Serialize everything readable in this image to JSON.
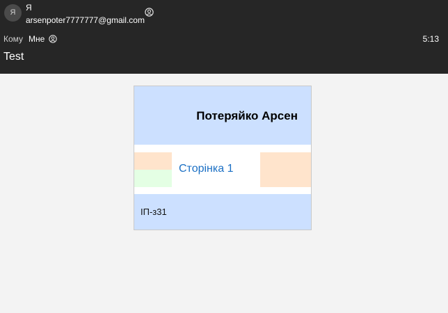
{
  "header": {
    "avatar_letter": "Я",
    "sender_name": "Я",
    "sender_email": "arsenpoter7777777@gmail.com",
    "to_label": "Кому",
    "to_value": "Мне",
    "time": "5:13",
    "subject": "Test"
  },
  "email_body": {
    "name": "Потеряйко Арсен",
    "link_text": "Сторінка 1",
    "group": "ІП-з31"
  },
  "colors": {
    "header_bg": "#262626",
    "page_bg": "#f3f3f3",
    "card_blue": "#cce0ff",
    "peach": "#ffe4cc",
    "light_green": "#e4ffe4",
    "link": "#1a6fc4"
  },
  "icons": [
    "contact-icon"
  ]
}
